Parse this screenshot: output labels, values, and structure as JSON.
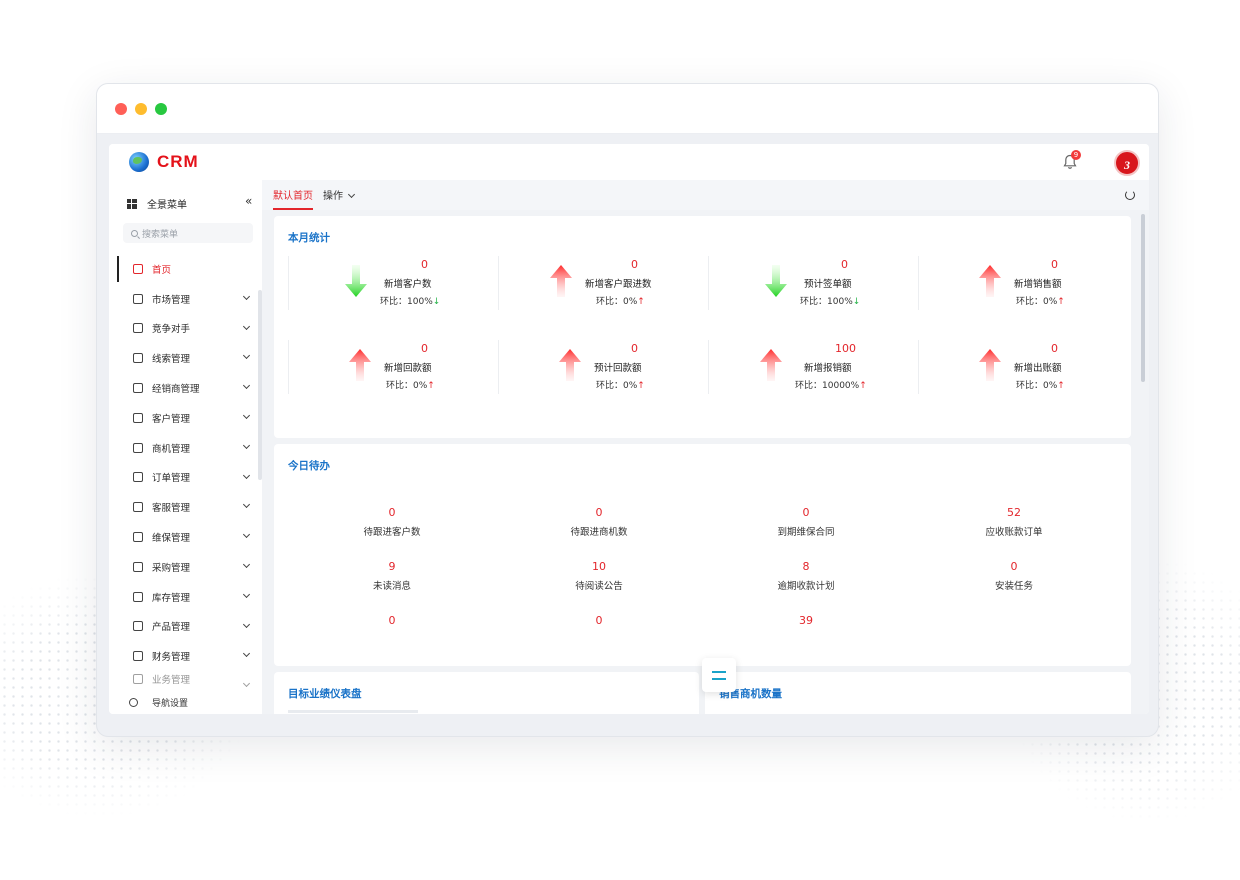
{
  "app": {
    "logo_text": "CRM",
    "notification_count": "9",
    "avatar_text": "3"
  },
  "sidebar": {
    "header_label": "全景菜单",
    "collapse_icon": "«",
    "search_placeholder": "搜索菜单",
    "items": [
      {
        "label": "首页",
        "icon": "home-icon",
        "active": true
      },
      {
        "label": "市场管理",
        "icon": "market-icon"
      },
      {
        "label": "竞争对手",
        "icon": "competitor-icon"
      },
      {
        "label": "线索管理",
        "icon": "lead-icon"
      },
      {
        "label": "经销商管理",
        "icon": "dealer-icon"
      },
      {
        "label": "客户管理",
        "icon": "customer-icon"
      },
      {
        "label": "商机管理",
        "icon": "opportunity-icon"
      },
      {
        "label": "订单管理",
        "icon": "order-icon"
      },
      {
        "label": "客服管理",
        "icon": "service-icon"
      },
      {
        "label": "维保管理",
        "icon": "maintenance-icon"
      },
      {
        "label": "采购管理",
        "icon": "purchase-icon"
      },
      {
        "label": "库存管理",
        "icon": "inventory-icon"
      },
      {
        "label": "产品管理",
        "icon": "product-icon"
      },
      {
        "label": "财务管理",
        "icon": "finance-icon"
      },
      {
        "label": "业务管理",
        "icon": "business-icon"
      }
    ],
    "footer_label": "导航设置"
  },
  "tabs": {
    "home": "默认首页",
    "operate": "操作"
  },
  "monthly": {
    "title": "本月统计",
    "stats": [
      {
        "value": "0",
        "label": "新增客户数",
        "ratio_label": "环比：",
        "ratio": "100%",
        "trend": "down"
      },
      {
        "value": "0",
        "label": "新增客户跟进数",
        "ratio_label": "环比：",
        "ratio": "0%",
        "trend": "up"
      },
      {
        "value": "0",
        "label": "预计签单额",
        "ratio_label": "环比：",
        "ratio": "100%",
        "trend": "down"
      },
      {
        "value": "0",
        "label": "新增销售额",
        "ratio_label": "环比：",
        "ratio": "0%",
        "trend": "up"
      },
      {
        "value": "0",
        "label": "新增回款额",
        "ratio_label": "环比：",
        "ratio": "0%",
        "trend": "up"
      },
      {
        "value": "0",
        "label": "预计回款额",
        "ratio_label": "环比：",
        "ratio": "0%",
        "trend": "up"
      },
      {
        "value": "100",
        "label": "新增报销额",
        "ratio_label": "环比：",
        "ratio": "10000%",
        "trend": "up"
      },
      {
        "value": "0",
        "label": "新增出账额",
        "ratio_label": "环比：",
        "ratio": "0%",
        "trend": "up"
      }
    ],
    "up_glyph": "↑",
    "down_glyph": "↓"
  },
  "todo": {
    "title": "今日待办",
    "items": [
      {
        "value": "0",
        "label": "待跟进客户数"
      },
      {
        "value": "0",
        "label": "待跟进商机数"
      },
      {
        "value": "0",
        "label": "到期维保合同"
      },
      {
        "value": "52",
        "label": "应收账款订单"
      },
      {
        "value": "9",
        "label": "未读消息"
      },
      {
        "value": "10",
        "label": "待阅读公告"
      },
      {
        "value": "8",
        "label": "逾期收款计划"
      },
      {
        "value": "0",
        "label": "安装任务"
      },
      {
        "value": "0",
        "label": ""
      },
      {
        "value": "0",
        "label": ""
      },
      {
        "value": "39",
        "label": ""
      }
    ]
  },
  "bottom": {
    "left_title": "目标业绩仪表盘",
    "right_title": "销售商机数量"
  },
  "colors": {
    "accent_red": "#e3262c",
    "title_blue": "#1a73c8",
    "trend_green": "#27b34a"
  }
}
